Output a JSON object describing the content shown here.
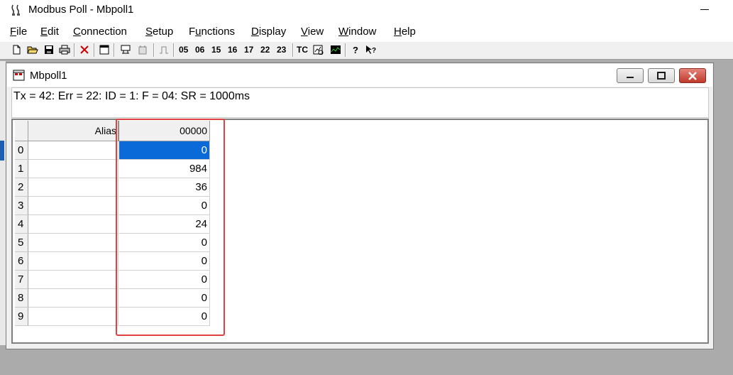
{
  "app": {
    "title": "Modbus Poll - Mbpoll1"
  },
  "menu": {
    "items": [
      {
        "label": "File",
        "mnemonic": "F",
        "rest": "ile"
      },
      {
        "label": "Edit",
        "mnemonic": "E",
        "rest": "dit"
      },
      {
        "label": "Connection",
        "mnemonic": "C",
        "rest": "onnection"
      },
      {
        "label": "Setup",
        "mnemonic": "S",
        "rest": "etup"
      },
      {
        "label": "Functions",
        "mnemonic": "u",
        "pre": "F",
        "rest": "nctions"
      },
      {
        "label": "Display",
        "mnemonic": "D",
        "rest": "isplay"
      },
      {
        "label": "View",
        "mnemonic": "V",
        "rest": "iew"
      },
      {
        "label": "Window",
        "mnemonic": "W",
        "rest": "indow"
      },
      {
        "label": "Help",
        "mnemonic": "H",
        "rest": "elp"
      }
    ]
  },
  "toolbar": {
    "function_codes": [
      "05",
      "06",
      "15",
      "16",
      "17",
      "22",
      "23"
    ],
    "tc_label": "TC",
    "icons": [
      "new-document-icon",
      "open-folder-icon",
      "save-icon",
      "print-icon",
      "disconnect-icon",
      "window-icon",
      "connect-icon",
      "data-log-icon",
      "pulse-icon",
      "tc-icon",
      "communication-traffic-icon",
      "chart-icon",
      "help-icon",
      "whats-this-help-icon"
    ]
  },
  "child": {
    "title": "Mbpoll1",
    "status": "Tx = 42: Err = 22: ID = 1: F = 04: SR = 1000ms"
  },
  "grid": {
    "alias_header": "Alias",
    "address_header": "00000",
    "rows": [
      {
        "index": "0",
        "value": "0",
        "selected": true
      },
      {
        "index": "1",
        "value": "984"
      },
      {
        "index": "2",
        "value": "36"
      },
      {
        "index": "3",
        "value": "0"
      },
      {
        "index": "4",
        "value": "24"
      },
      {
        "index": "5",
        "value": "0"
      },
      {
        "index": "6",
        "value": "0"
      },
      {
        "index": "7",
        "value": "0"
      },
      {
        "index": "8",
        "value": "0"
      },
      {
        "index": "9",
        "value": "0"
      }
    ]
  },
  "colors": {
    "selection": "#0a6ad8",
    "highlight_box": "#e0423e",
    "workspace": "#ababab"
  }
}
